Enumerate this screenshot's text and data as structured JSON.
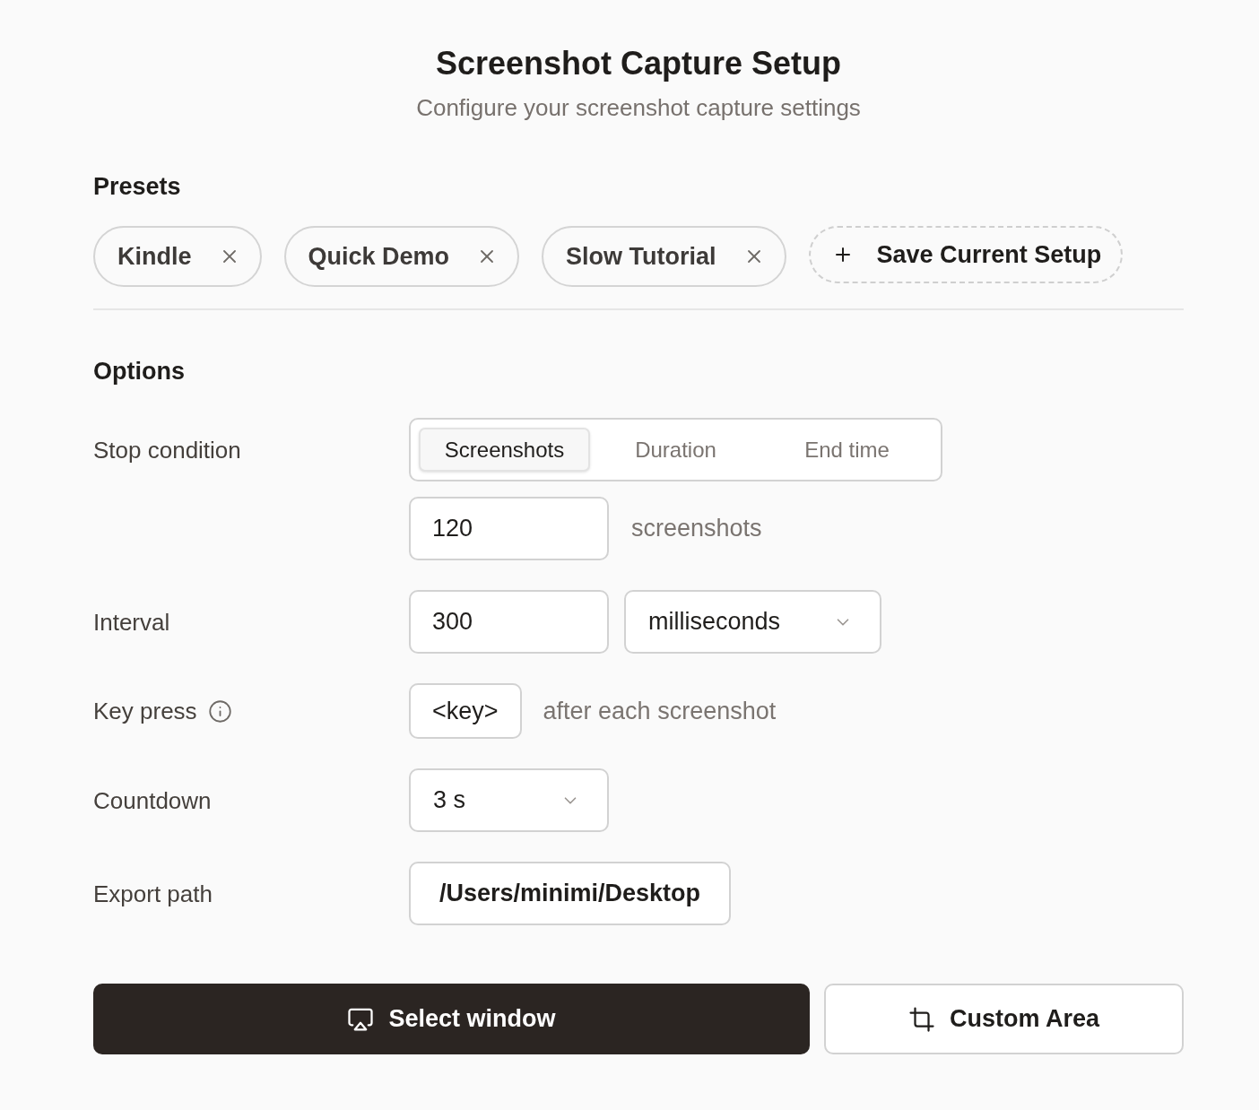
{
  "header": {
    "title": "Screenshot Capture Setup",
    "subtitle": "Configure your screenshot capture settings"
  },
  "presets": {
    "heading": "Presets",
    "items": [
      {
        "label": "Kindle"
      },
      {
        "label": "Quick Demo"
      },
      {
        "label": "Slow Tutorial"
      }
    ],
    "save_label": "Save Current Setup"
  },
  "options": {
    "heading": "Options",
    "stop_condition": {
      "label": "Stop condition",
      "tabs": [
        {
          "label": "Screenshots",
          "selected": true
        },
        {
          "label": "Duration",
          "selected": false
        },
        {
          "label": "End time",
          "selected": false
        }
      ],
      "count_value": "120",
      "count_unit": "screenshots"
    },
    "interval": {
      "label": "Interval",
      "value": "300",
      "unit": "milliseconds"
    },
    "key_press": {
      "label": "Key press",
      "key": "<key>",
      "suffix": "after each screenshot"
    },
    "countdown": {
      "label": "Countdown",
      "value": "3 s"
    },
    "export_path": {
      "label": "Export path",
      "value": "/Users/minimi/Desktop"
    }
  },
  "actions": [
    {
      "kind": "primary",
      "label": "Select window"
    },
    {
      "kind": "secondary",
      "label": "Custom Area"
    }
  ]
}
